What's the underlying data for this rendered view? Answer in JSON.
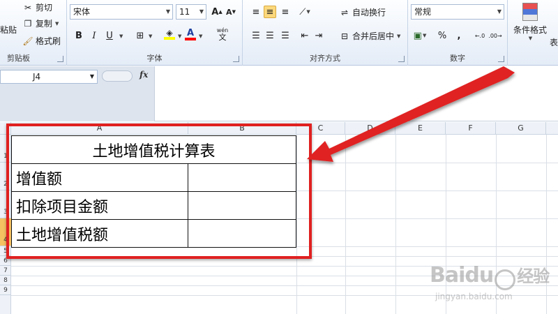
{
  "ribbon": {
    "clipboard": {
      "paste_label": "粘贴",
      "cut_label": "剪切",
      "copy_label": "复制",
      "format_painter_label": "格式刷",
      "group_label": "剪贴板"
    },
    "font": {
      "font_name": "宋体",
      "font_size": "11",
      "bold": "B",
      "italic": "I",
      "underline": "U",
      "grow": "A",
      "shrink": "A",
      "font_color_glyph": "A",
      "phonetic_glyph": "wén",
      "group_label": "字体",
      "colors": {
        "fill": "#ffff00",
        "font": "#ff0000"
      }
    },
    "alignment": {
      "wrap_text_label": "自动换行",
      "merge_center_label": "合并后居中",
      "group_label": "对齐方式"
    },
    "number": {
      "format_value": "常规",
      "percent": "%",
      "comma": ",",
      "group_label": "数字"
    },
    "styles": {
      "conditional_formatting_label": "条件格式",
      "format_as_table_label": "表"
    }
  },
  "formula_bar": {
    "name_box_value": "J4",
    "fx_label": "fx",
    "formula_value": ""
  },
  "grid": {
    "columns": [
      "A",
      "B",
      "C",
      "D",
      "E",
      "F",
      "G"
    ],
    "rows": [
      "1",
      "2",
      "3",
      "4",
      "5",
      "6",
      "7",
      "8",
      "9"
    ],
    "selected_row": "4"
  },
  "table": {
    "title": "土地增值税计算表",
    "rows": [
      {
        "label": "增值额",
        "value": ""
      },
      {
        "label": "扣除项目金额",
        "value": ""
      },
      {
        "label": "土地增值税额",
        "value": ""
      }
    ]
  },
  "annotation": {
    "color": "#e02020"
  },
  "watermark": {
    "brand": "Baidu",
    "brand_suffix": "经验",
    "url": "jingyan.baidu.com"
  }
}
